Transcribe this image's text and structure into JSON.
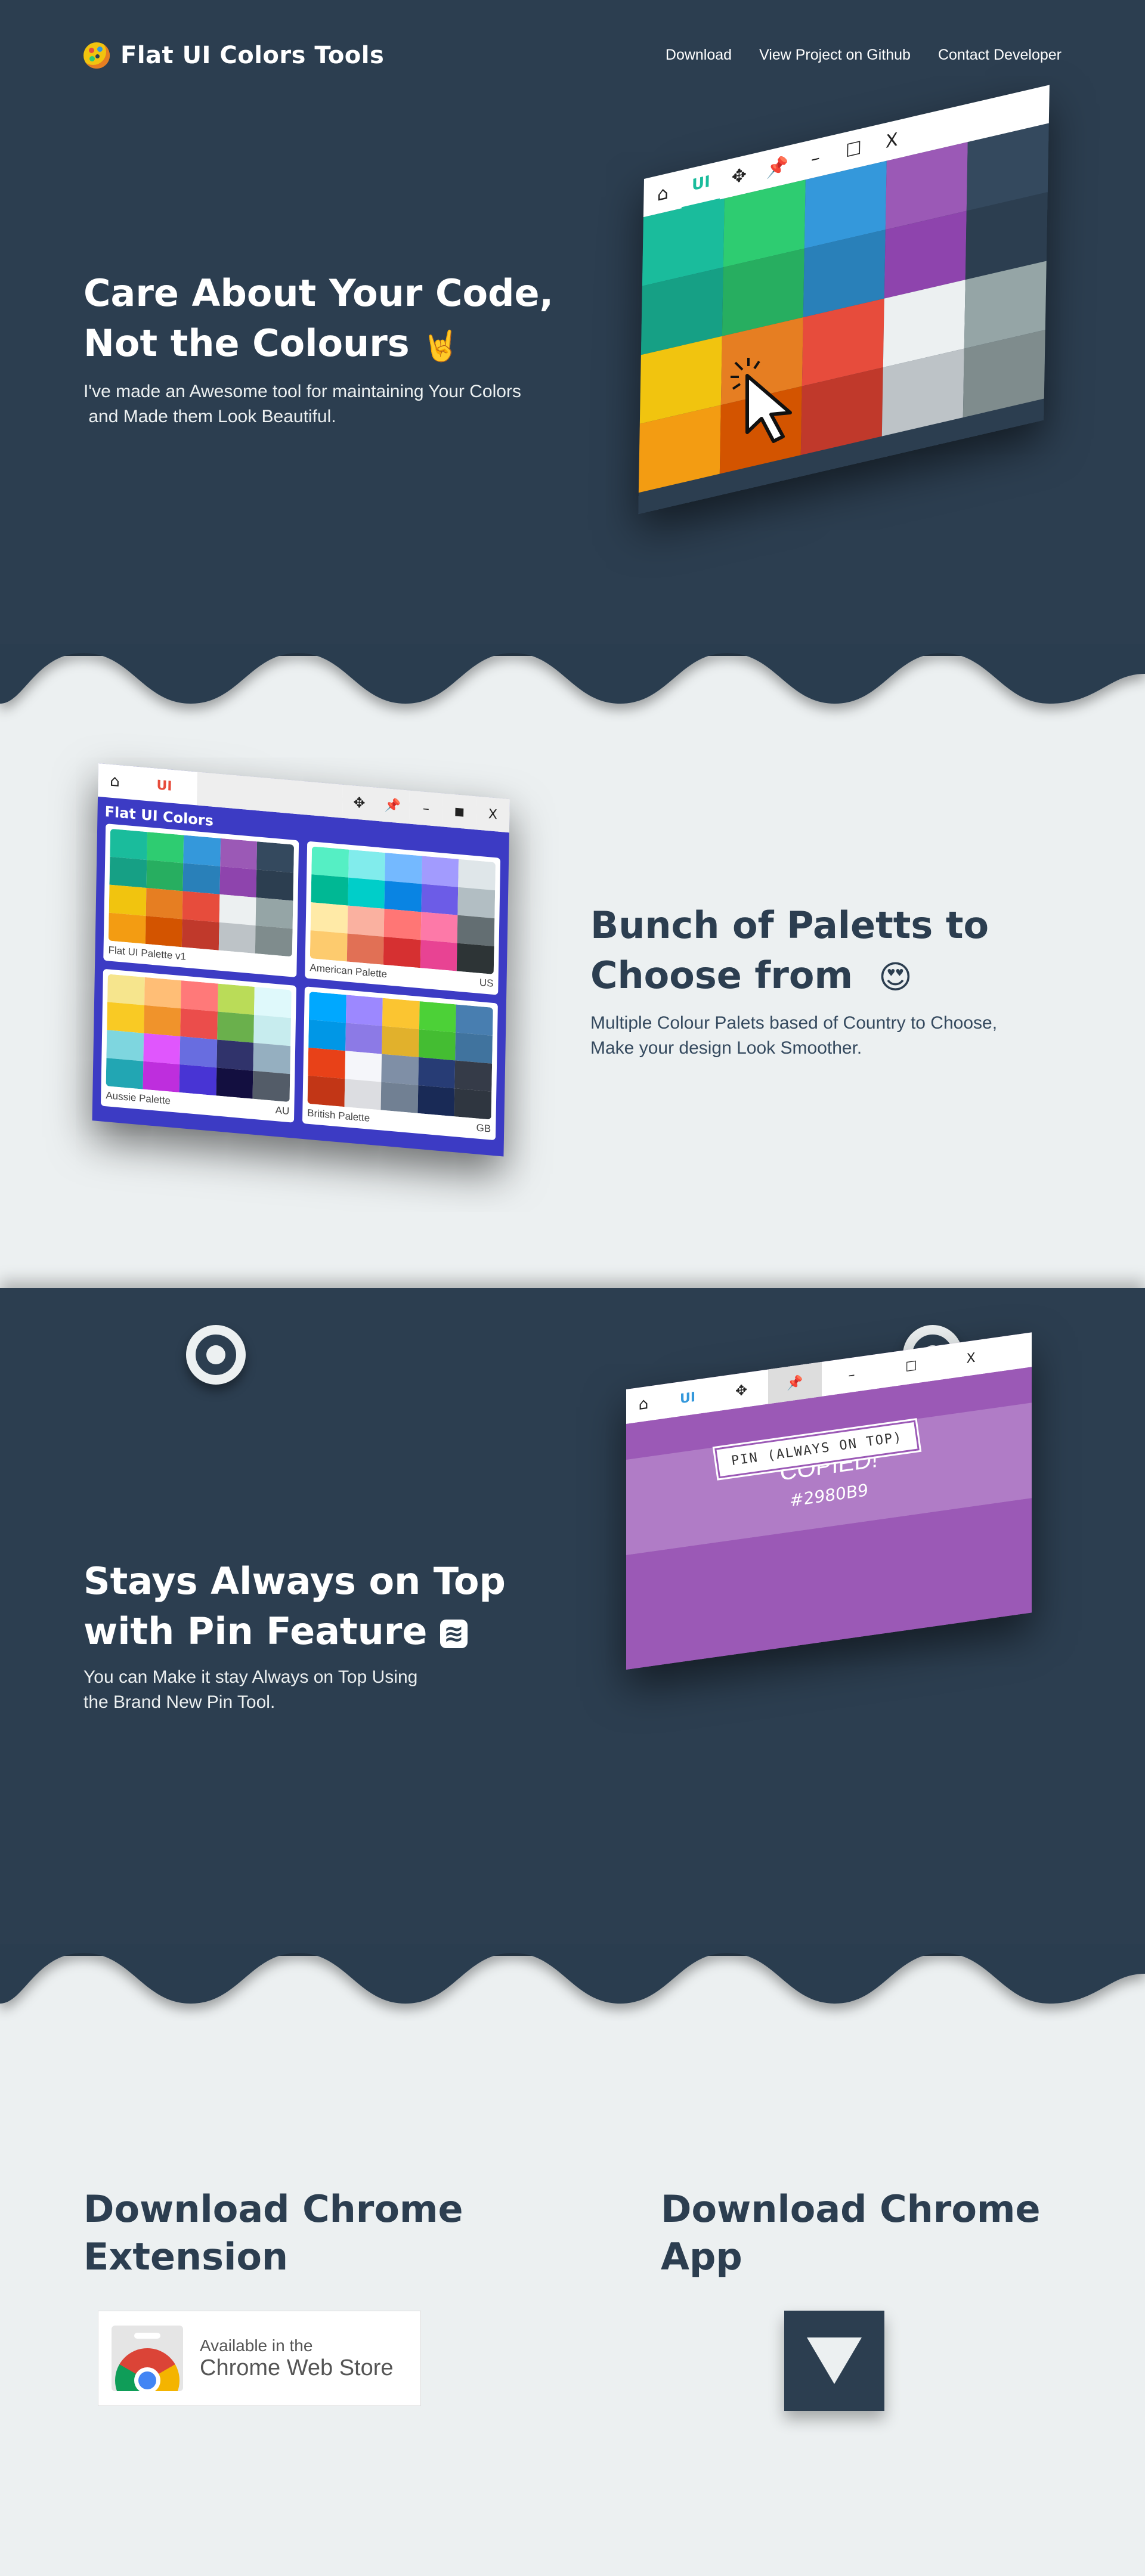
{
  "brand": {
    "name": "Flat UI Colors Tools",
    "logo_icon": "palette-icon"
  },
  "nav": {
    "items": [
      {
        "label": "Download"
      },
      {
        "label": "View Project on Github"
      },
      {
        "label": "Contact Developer"
      }
    ]
  },
  "colors": {
    "dark": "#2c3e50",
    "light": "#ecf0f1",
    "purple_window": "#9b59b6",
    "palette_window": "#3c3bc4"
  },
  "hero": {
    "title_line1": "Care About Your Code,",
    "title_line2": "Not the Colours",
    "title_emoji": "🤘",
    "subtitle_line1": "I've made an Awesome tool for maintaining Your Colors",
    "subtitle_line2": "and Made them Look Beautiful.",
    "window": {
      "tabs": [
        "home-icon",
        "UI",
        "move-icon",
        "pin-icon",
        "minimize-icon",
        "maximize-icon",
        "X"
      ],
      "swatches": [
        "#1abc9c",
        "#2ecc71",
        "#3498db",
        "#9b59b6",
        "#34495e",
        "#16a085",
        "#27ae60",
        "#2980b9",
        "#8e44ad",
        "#2c3e50",
        "#f1c40f",
        "#e67e22",
        "#e74c3c",
        "#ecf0f1",
        "#95a5a6",
        "#f39c12",
        "#d35400",
        "#c0392b",
        "#bdc3c7",
        "#7f8c8d"
      ]
    }
  },
  "palettes": {
    "title_line1": "Bunch of Paletts to",
    "title_line2": "Choose from",
    "title_emoji": "😍",
    "subtitle_line1": "Multiple Colour Palets based of Country  to Choose,",
    "subtitle_line2": "Make your design Look Smoother.",
    "window": {
      "header": "Flat UI Colors",
      "tab_ui": "UI",
      "cards": [
        {
          "name": "Flat UI Palette v1",
          "code": "",
          "colors": [
            "#1abc9c",
            "#2ecc71",
            "#3498db",
            "#9b59b6",
            "#34495e",
            "#16a085",
            "#27ae60",
            "#2980b9",
            "#8e44ad",
            "#2c3e50",
            "#f1c40f",
            "#e67e22",
            "#e74c3c",
            "#ecf0f1",
            "#95a5a6",
            "#f39c12",
            "#d35400",
            "#c0392b",
            "#bdc3c7",
            "#7f8c8d"
          ]
        },
        {
          "name": "American Palette",
          "code": "US",
          "colors": [
            "#55efc4",
            "#81ecec",
            "#74b9ff",
            "#a29bfe",
            "#dfe6e9",
            "#00b894",
            "#00cec9",
            "#0984e3",
            "#6c5ce7",
            "#b2bec3",
            "#ffeaa7",
            "#fab1a0",
            "#ff7675",
            "#fd79a8",
            "#636e72",
            "#fdcb6e",
            "#e17055",
            "#d63031",
            "#e84393",
            "#2d3436"
          ]
        },
        {
          "name": "Aussie Palette",
          "code": "AU",
          "colors": [
            "#f6e58d",
            "#ffbe76",
            "#ff7979",
            "#badc58",
            "#dff9fb",
            "#f9ca24",
            "#f0932b",
            "#eb4d4b",
            "#6ab04c",
            "#c7ecee",
            "#7ed6df",
            "#e056fd",
            "#686de0",
            "#30336b",
            "#95afc0",
            "#22a6b3",
            "#be2edd",
            "#4834d4",
            "#130f40",
            "#535c68"
          ]
        },
        {
          "name": "British Palette",
          "code": "GB",
          "colors": [
            "#00a8ff",
            "#9c88ff",
            "#fbc531",
            "#4cd137",
            "#487eb0",
            "#0097e6",
            "#8c7ae6",
            "#e1b12c",
            "#44bd32",
            "#40739e",
            "#e84118",
            "#f5f6fa",
            "#7f8fa6",
            "#273c75",
            "#353b48",
            "#c23616",
            "#dcdde1",
            "#718093",
            "#192a56",
            "#2f3640"
          ]
        }
      ]
    }
  },
  "pin": {
    "title_line1": "Stays Always on Top",
    "title_line2": "with Pin Feature",
    "title_emoji": "≋",
    "subtitle_line1": "You can Make it stay Always on Top Using",
    "subtitle_line2": "the Brand New Pin Tool.",
    "window": {
      "tab_ui": "UI",
      "tooltip": "PIN (ALWAYS ON TOP)",
      "copied": "COPIED!",
      "hex": "#2980B9",
      "close": "X"
    }
  },
  "download": {
    "extension_title_line1": "Download Chrome",
    "extension_title_line2": "Extension",
    "app_title_line1": "Download Chrome",
    "app_title_line2": "App",
    "store_badge_line1": "Available in the",
    "store_badge_line2": "Chrome Web Store"
  }
}
